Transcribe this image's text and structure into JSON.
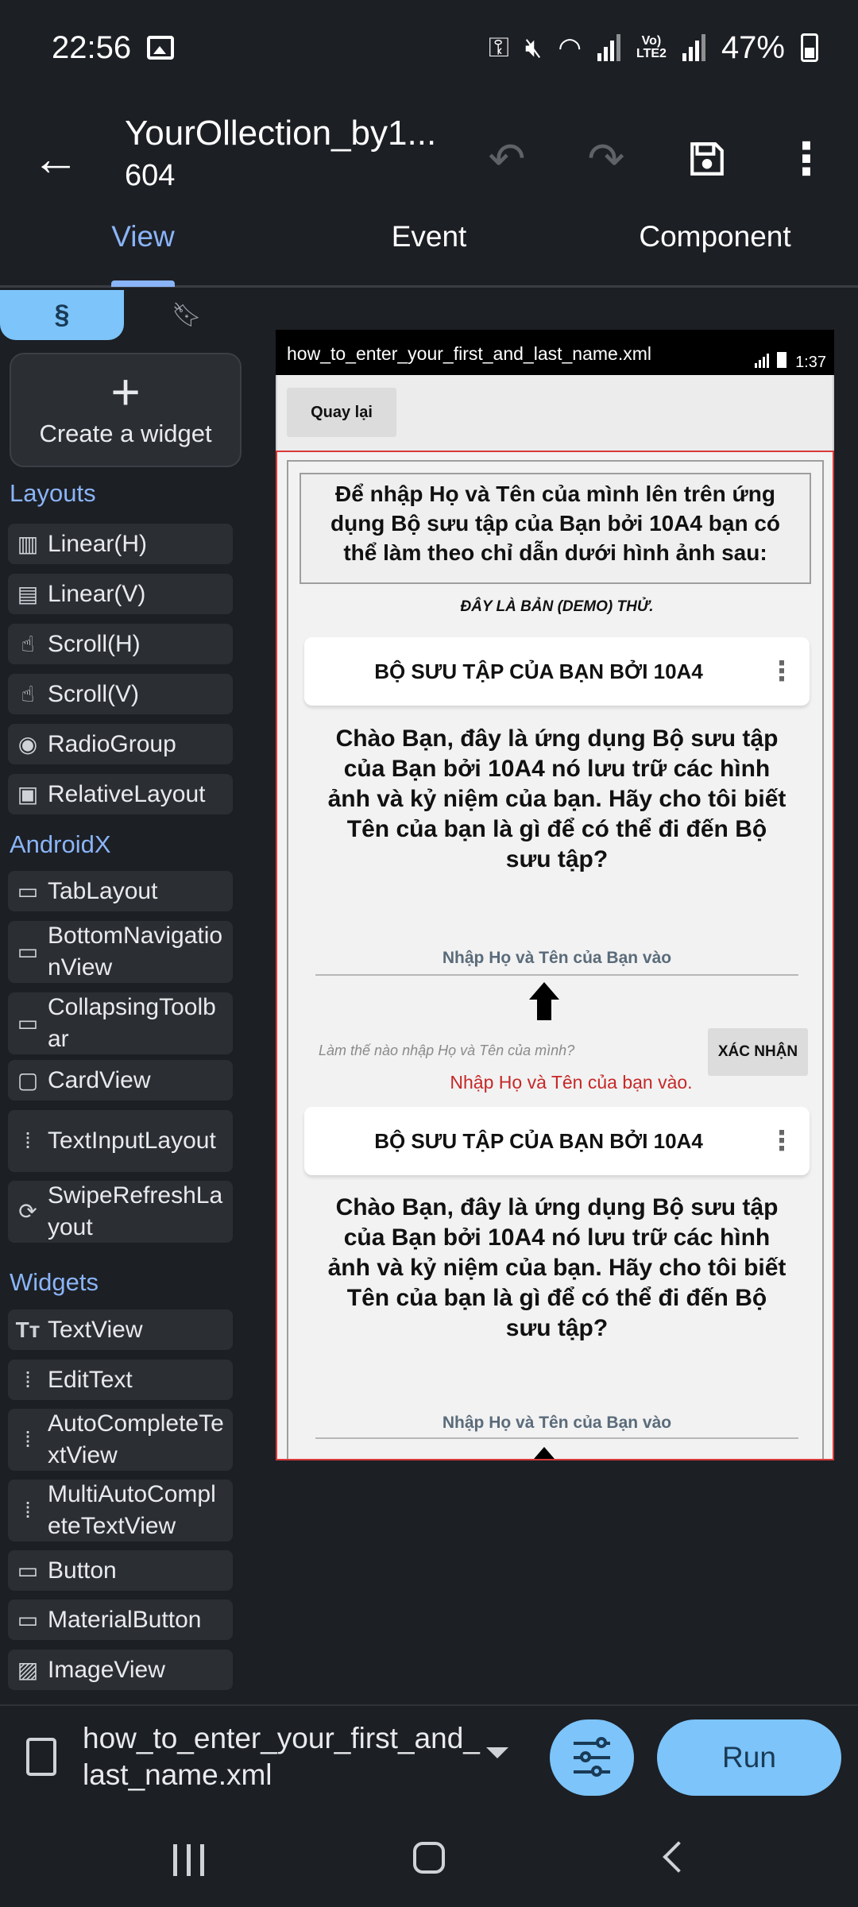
{
  "status_bar": {
    "time": "22:56",
    "battery": "47%",
    "network": "LTE2"
  },
  "app_bar": {
    "title": "YourOllection_by1...",
    "subtitle": "604"
  },
  "tabs": [
    "View",
    "Event",
    "Component"
  ],
  "palette": {
    "create_widget": "Create a widget",
    "sections": {
      "layouts": "Layouts",
      "androidx": "AndroidX",
      "widgets": "Widgets"
    },
    "layouts": [
      "Linear(H)",
      "Linear(V)",
      "Scroll(H)",
      "Scroll(V)",
      "RadioGroup",
      "RelativeLayout"
    ],
    "androidx": [
      "TabLayout",
      "BottomNavigationView",
      "CollapsingToolbar",
      "CardView",
      "TextInputLayout",
      "SwipeRefreshLayout"
    ],
    "widgets": [
      "TextView",
      "EditText",
      "AutoCompleteTextView",
      "MultiAutoCompleteTextView",
      "Button",
      "MaterialButton",
      "ImageView"
    ]
  },
  "preview": {
    "file_title": "how_to_enter_your_first_and_last_name.xml",
    "time": "1:37",
    "back_button": "Quay lại",
    "intro": "Để nhập Họ và Tên của mình lên trên ứng dụng Bộ sưu tập của Bạn bởi 10A4 bạn có thể làm theo chỉ dẫn dưới hình ảnh sau:",
    "demo_note": "ĐÂY LÀ BẢN (DEMO) THỬ.",
    "card_title": "BỘ SƯU TẬP CỦA BẠN BỞI 10A4",
    "card_body": "Chào Bạn, đây là ứng dụng Bộ sưu tập của Bạn bởi 10A4 nó lưu trữ các hình ảnh và kỷ niệm của bạn. Hãy cho tôi biết Tên của bạn là gì để có thể đi đến Bộ sưu tập?",
    "input_hint": "Nhập Họ và Tên của Bạn vào",
    "how_link": "Làm thế nào nhập Họ và Tên của mình?",
    "confirm_button": "XÁC NHẬN",
    "error_text": "Nhập Họ và Tên của bạn vào.",
    "card2_title": "BỘ SƯU TẬP CỦA BẠN BỞI 10A4",
    "card2_body": "Chào Bạn, đây là ứng dụng Bộ sưu tập của Bạn bởi 10A4 nó lưu trữ các hình ảnh và kỷ niệm của bạn. Hãy cho tôi biết Tên của bạn là gì để có thể đi đến Bộ sưu tập?",
    "input_hint2": "Nhập Họ và Tên của Bạn vào"
  },
  "bottom_bar": {
    "file_name": "how_to_enter_your_first_and_last_name.xml",
    "run_label": "Run"
  },
  "colors": {
    "accent": "#8ab4f8",
    "button_fill": "#7cc4fa",
    "error": "#c62828",
    "background": "#1c1f24"
  }
}
